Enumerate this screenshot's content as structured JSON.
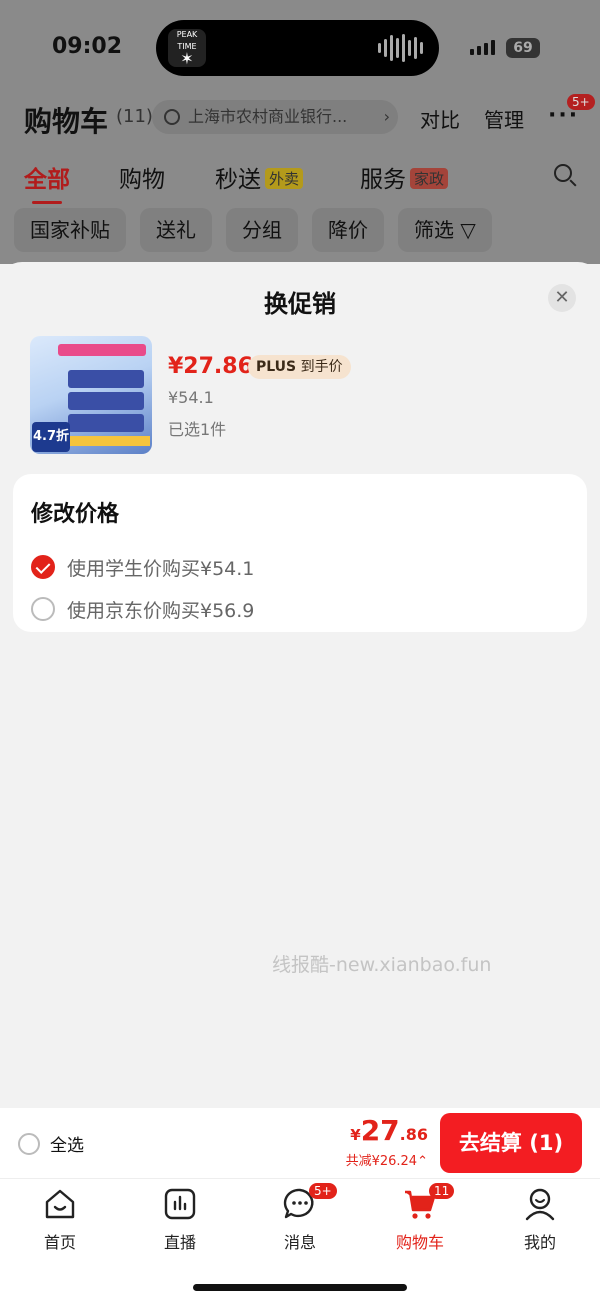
{
  "status_bar": {
    "time": "09:02",
    "battery": "69",
    "island_thumb_text": "PEAK TIME"
  },
  "header": {
    "title": "购物车",
    "count": "(11)",
    "address": "上海市农村商业银行...",
    "compare": "对比",
    "manage": "管理",
    "more_badge": "5+"
  },
  "tabs": [
    {
      "label": "全部"
    },
    {
      "label": "购物"
    },
    {
      "label": "秒送",
      "tag": "外卖"
    },
    {
      "label": "服务",
      "tag": "家政"
    }
  ],
  "chips": [
    "国家补贴",
    "送礼",
    "分组",
    "降价",
    "筛选"
  ],
  "sheet": {
    "title": "换促销",
    "product": {
      "price": "¥27.86",
      "plus_badge_bold": "PLUS",
      "plus_badge_text": "到手价",
      "original_price": "¥54.1",
      "selected": "已选1件",
      "image_discount": "4.7折"
    },
    "price_card": {
      "title": "修改价格",
      "options": [
        {
          "label": "使用学生价购买¥54.1",
          "checked": true
        },
        {
          "label": "使用京东价购买¥56.9",
          "checked": false
        }
      ]
    }
  },
  "watermark": "线报酷-new.xianbao.fun",
  "checkout": {
    "select_all": "全选",
    "total_currency": "¥",
    "total_int": "27",
    "total_dec": ".86",
    "saved": "共减¥26.24",
    "pay_button": "去结算 (1)"
  },
  "tabbar": [
    {
      "label": "首页",
      "icon": "home-icon"
    },
    {
      "label": "直播",
      "icon": "live-icon"
    },
    {
      "label": "消息",
      "icon": "message-icon",
      "badge": "5+"
    },
    {
      "label": "购物车",
      "icon": "cart-icon",
      "badge": "11",
      "active": true
    },
    {
      "label": "我的",
      "icon": "profile-icon"
    }
  ],
  "colors": {
    "accent": "#e2231a",
    "pay_button": "#f31d22",
    "plus_badge_bg": "#f6e3cf",
    "overlay": "#8a8a8a"
  }
}
